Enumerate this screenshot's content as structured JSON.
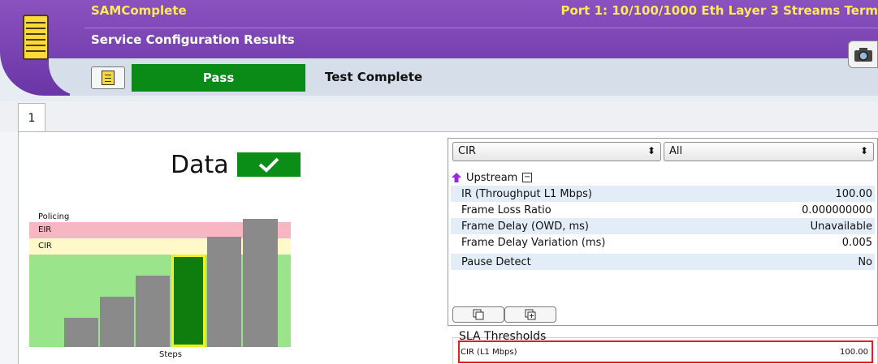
{
  "header": {
    "app_name": "SAMComplete",
    "subtitle": "Service Configuration Results",
    "port_info": "Port 1: 10/100/1000 Eth Layer 3 Streams Term",
    "result": "Pass",
    "status": "Test Complete"
  },
  "tabs": [
    {
      "label": "1"
    }
  ],
  "left": {
    "title": "Data",
    "policing_label": "Policing",
    "eir_label": "EIR",
    "cir_label": "CIR",
    "steps_label": "Steps",
    "steps_count": 6,
    "active_step": 4
  },
  "right": {
    "metric_select": "CIR",
    "filter_select": "All",
    "stream_label": "Upstream",
    "rows": [
      {
        "label": "IR (Throughput L1 Mbps)",
        "value": "100.00"
      },
      {
        "label": "Frame Loss Ratio",
        "value": "0.000000000"
      },
      {
        "label": "Frame Delay (OWD, ms)",
        "value": "Unavailable"
      },
      {
        "label": "Frame Delay Variation (ms)",
        "value": "0.005"
      },
      {
        "label": "Pause Detect",
        "value": "No"
      }
    ],
    "sla": {
      "title": "SLA Thresholds",
      "rows": [
        {
          "label": "CIR (L1 Mbps)",
          "value": "100.00"
        }
      ]
    }
  },
  "colors": {
    "header_purple": "#7a43b2",
    "title_yellow": "#ffe95a",
    "pass_green": "#0a8a17",
    "eir_pink": "#f8b5c2",
    "cir_yellow": "#fff8c9",
    "ok_green": "#9ae48b",
    "alert_red": "#e02020"
  },
  "icons": [
    "app-menu-icon",
    "camera-icon",
    "document-icon",
    "check-icon",
    "up-arrow-icon",
    "collapse-icon",
    "copy-icon",
    "add-icon",
    "dropdown-arrow-icon"
  ]
}
